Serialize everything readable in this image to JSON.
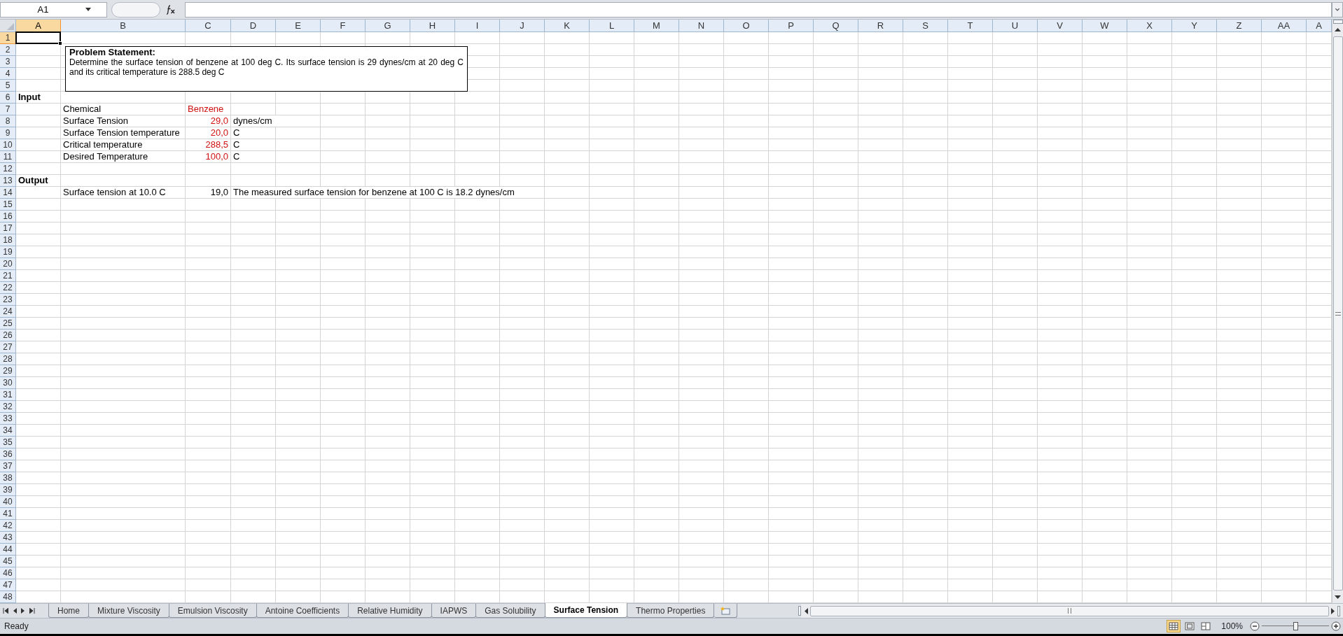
{
  "name_box": "A1",
  "columns": [
    {
      "label": "A",
      "selected": true
    },
    {
      "label": "B",
      "selected": false
    },
    {
      "label": "C",
      "selected": false
    },
    {
      "label": "D",
      "selected": false
    },
    {
      "label": "E",
      "selected": false
    },
    {
      "label": "F",
      "selected": false
    },
    {
      "label": "G",
      "selected": false
    },
    {
      "label": "H",
      "selected": false
    },
    {
      "label": "I",
      "selected": false
    },
    {
      "label": "J",
      "selected": false
    },
    {
      "label": "K",
      "selected": false
    },
    {
      "label": "L",
      "selected": false
    },
    {
      "label": "M",
      "selected": false
    },
    {
      "label": "N",
      "selected": false
    },
    {
      "label": "O",
      "selected": false
    },
    {
      "label": "P",
      "selected": false
    },
    {
      "label": "Q",
      "selected": false
    },
    {
      "label": "R",
      "selected": false
    },
    {
      "label": "S",
      "selected": false
    },
    {
      "label": "T",
      "selected": false
    },
    {
      "label": "U",
      "selected": false
    },
    {
      "label": "V",
      "selected": false
    },
    {
      "label": "W",
      "selected": false
    },
    {
      "label": "X",
      "selected": false
    },
    {
      "label": "Y",
      "selected": false
    },
    {
      "label": "Z",
      "selected": false
    },
    {
      "label": "AA",
      "selected": false
    },
    {
      "label": "A",
      "selected": false
    }
  ],
  "rows": [
    {
      "label": "1",
      "selected": true
    },
    {
      "label": "2",
      "selected": false
    },
    {
      "label": "3",
      "selected": false
    },
    {
      "label": "4",
      "selected": false
    },
    {
      "label": "5",
      "selected": false
    },
    {
      "label": "6",
      "selected": false,
      "cells": {
        "A": {
          "kind": "heading",
          "text": "Input"
        }
      }
    },
    {
      "label": "7",
      "selected": false,
      "cells": {
        "B": {
          "kind": "text",
          "text": "Chemical"
        },
        "C": {
          "kind": "input_text",
          "text": "Benzene"
        }
      }
    },
    {
      "label": "8",
      "selected": false,
      "cells": {
        "B": {
          "kind": "text",
          "text": "Surface Tension"
        },
        "C": {
          "kind": "input_number",
          "text": "29,0"
        },
        "D": {
          "kind": "text",
          "text": "dynes/cm"
        }
      }
    },
    {
      "label": "9",
      "selected": false,
      "cells": {
        "B": {
          "kind": "text",
          "text": "Surface Tension temperature"
        },
        "C": {
          "kind": "input_number",
          "text": "20,0"
        },
        "D": {
          "kind": "text",
          "text": "C"
        }
      }
    },
    {
      "label": "10",
      "selected": false,
      "cells": {
        "B": {
          "kind": "text",
          "text": "Critical temperature"
        },
        "C": {
          "kind": "input_number",
          "text": "288,5"
        },
        "D": {
          "kind": "text",
          "text": "C"
        }
      }
    },
    {
      "label": "11",
      "selected": false,
      "cells": {
        "B": {
          "kind": "text",
          "text": "Desired Temperature"
        },
        "C": {
          "kind": "input_number",
          "text": "100,0"
        },
        "D": {
          "kind": "text",
          "text": "C"
        }
      }
    },
    {
      "label": "12",
      "selected": false
    },
    {
      "label": "13",
      "selected": false,
      "cells": {
        "A": {
          "kind": "heading",
          "text": "Output"
        }
      }
    },
    {
      "label": "14",
      "selected": false,
      "cells": {
        "B": {
          "kind": "text",
          "text": "Surface tension at 10.0 C"
        },
        "C": {
          "kind": "number",
          "text": "19,0"
        },
        "D": {
          "kind": "text",
          "text": "The measured surface tension for benzene at 100 C is 18.2 dynes/cm"
        }
      }
    },
    {
      "label": "15",
      "selected": false
    },
    {
      "label": "16",
      "selected": false
    },
    {
      "label": "17",
      "selected": false
    },
    {
      "label": "18",
      "selected": false
    },
    {
      "label": "19",
      "selected": false
    },
    {
      "label": "20",
      "selected": false
    },
    {
      "label": "21",
      "selected": false
    },
    {
      "label": "22",
      "selected": false
    },
    {
      "label": "23",
      "selected": false
    },
    {
      "label": "24",
      "selected": false
    },
    {
      "label": "25",
      "selected": false
    },
    {
      "label": "26",
      "selected": false
    },
    {
      "label": "27",
      "selected": false
    },
    {
      "label": "28",
      "selected": false
    },
    {
      "label": "29",
      "selected": false
    },
    {
      "label": "30",
      "selected": false
    },
    {
      "label": "31",
      "selected": false
    },
    {
      "label": "32",
      "selected": false
    },
    {
      "label": "33",
      "selected": false
    },
    {
      "label": "34",
      "selected": false
    },
    {
      "label": "35",
      "selected": false
    },
    {
      "label": "36",
      "selected": false
    },
    {
      "label": "37",
      "selected": false
    },
    {
      "label": "38",
      "selected": false
    },
    {
      "label": "39",
      "selected": false
    },
    {
      "label": "40",
      "selected": false
    },
    {
      "label": "41",
      "selected": false
    },
    {
      "label": "42",
      "selected": false
    },
    {
      "label": "43",
      "selected": false
    },
    {
      "label": "44",
      "selected": false
    },
    {
      "label": "45",
      "selected": false
    },
    {
      "label": "46",
      "selected": false
    },
    {
      "label": "47",
      "selected": false
    },
    {
      "label": "48",
      "selected": false
    }
  ],
  "text_box": {
    "title": "Problem Statement:",
    "body": "Determine the surface tension of benzene at 100 deg C. Its surface tension is 29 dynes/cm at 20 deg C and its critical temperature is 288.5 deg C"
  },
  "sheets": [
    {
      "label": "Home",
      "selected": false
    },
    {
      "label": "Mixture Viscosity",
      "selected": false
    },
    {
      "label": "Emulsion Viscosity",
      "selected": false
    },
    {
      "label": "Antoine Coefficients",
      "selected": false
    },
    {
      "label": "Relative Humidity",
      "selected": false
    },
    {
      "label": "IAPWS",
      "selected": false
    },
    {
      "label": "Gas Solubility",
      "selected": false
    },
    {
      "label": "Surface Tension",
      "selected": true
    },
    {
      "label": "Thermo Properties",
      "selected": false
    }
  ],
  "status_bar": {
    "status": "Ready",
    "views": [
      {
        "kind": "normal",
        "selected": true
      },
      {
        "kind": "page_layout",
        "selected": false
      },
      {
        "kind": "page_break",
        "selected": false
      }
    ],
    "zoom": "100%",
    "zoom_level": {
      "level": 0.5
    }
  }
}
